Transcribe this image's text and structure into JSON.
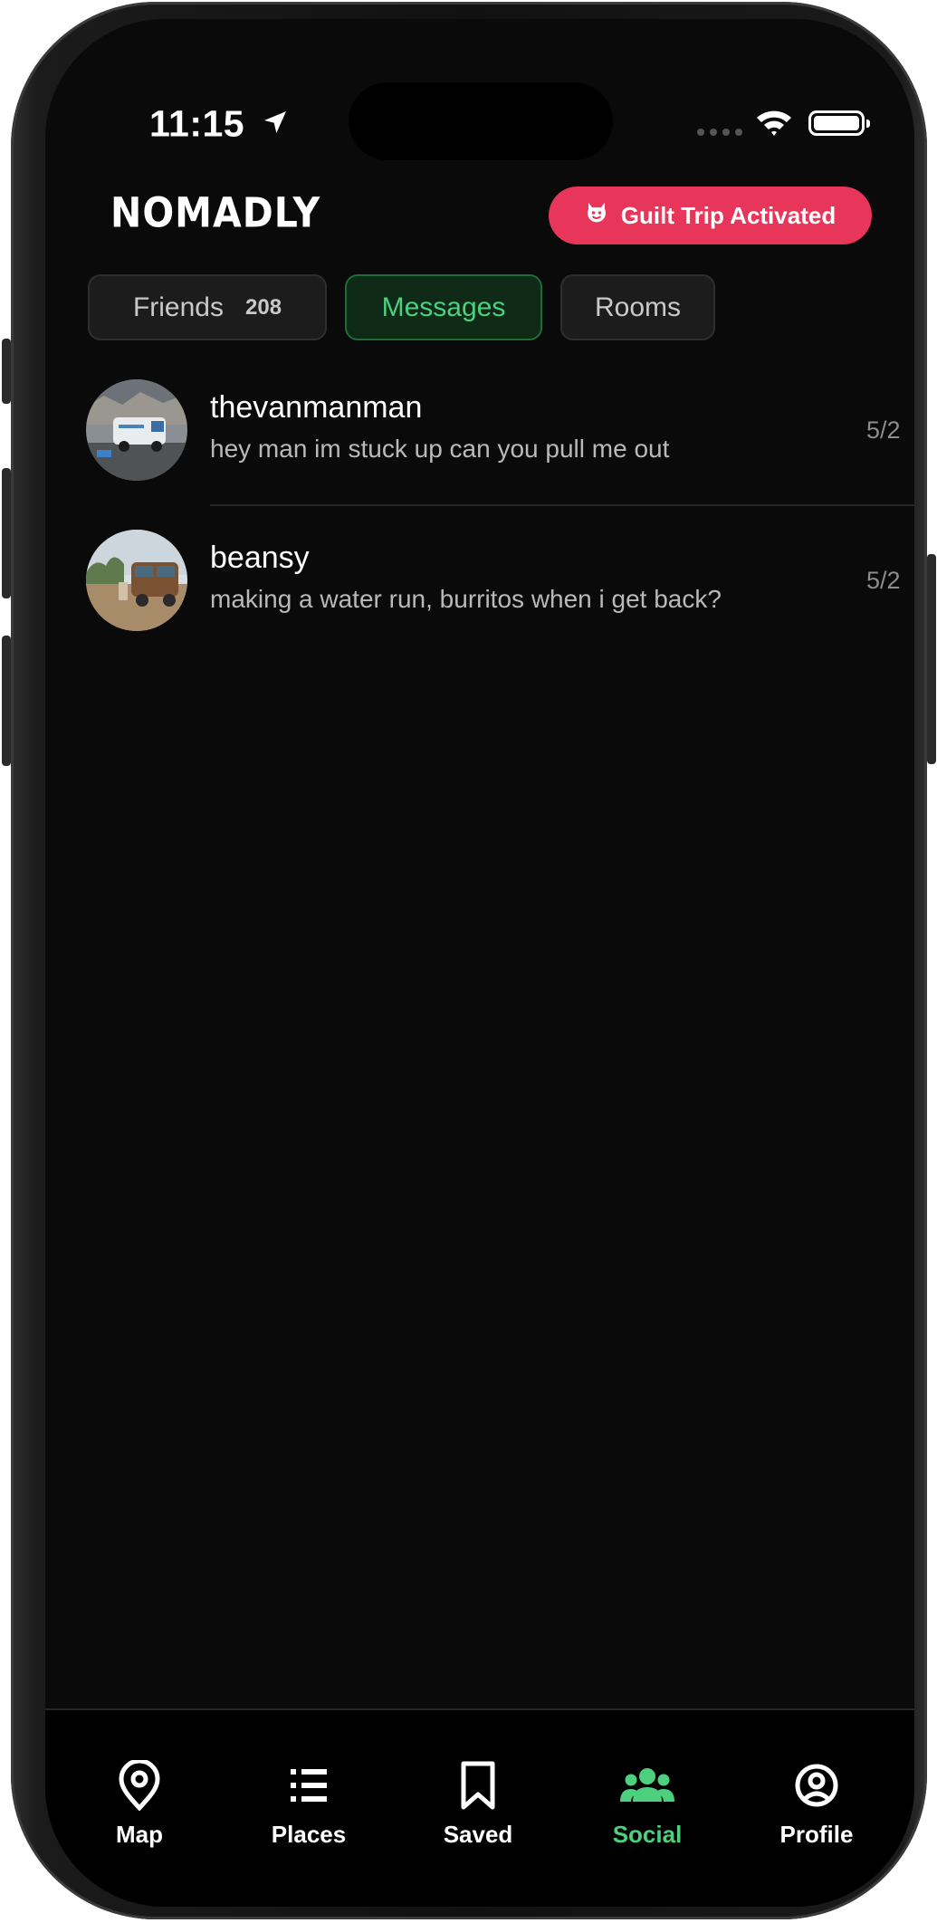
{
  "status_bar": {
    "time": "11:15",
    "location_icon": "location-arrow-icon",
    "wifi_icon": "wifi-icon",
    "battery_icon": "battery-icon"
  },
  "header": {
    "logo": "NOMADLY",
    "guilt_button": {
      "label": "Guilt Trip Activated",
      "icon": "devil-face-icon",
      "color": "#e8365a"
    }
  },
  "tabs": [
    {
      "label": "Friends",
      "count": "208",
      "active": false
    },
    {
      "label": "Messages",
      "active": true
    },
    {
      "label": "Rooms",
      "active": false
    }
  ],
  "messages": [
    {
      "name": "thevanmanman",
      "preview": "hey man im stuck up can you pull me out",
      "date": "5/2",
      "avatar": "van-on-rocks-photo"
    },
    {
      "name": "beansy",
      "preview": "making a water run, burritos when i get back?",
      "date": "5/2",
      "avatar": "vintage-van-desert-photo"
    }
  ],
  "bottom_nav": [
    {
      "label": "Map",
      "icon": "map-pin-icon",
      "active": false
    },
    {
      "label": "Places",
      "icon": "list-icon",
      "active": false
    },
    {
      "label": "Saved",
      "icon": "bookmark-icon",
      "active": false
    },
    {
      "label": "Social",
      "icon": "people-icon",
      "active": true
    },
    {
      "label": "Profile",
      "icon": "user-circle-icon",
      "active": false
    }
  ],
  "colors": {
    "accent_green": "#4cd07d",
    "accent_red": "#e8365a",
    "background": "#0a0a0a"
  }
}
